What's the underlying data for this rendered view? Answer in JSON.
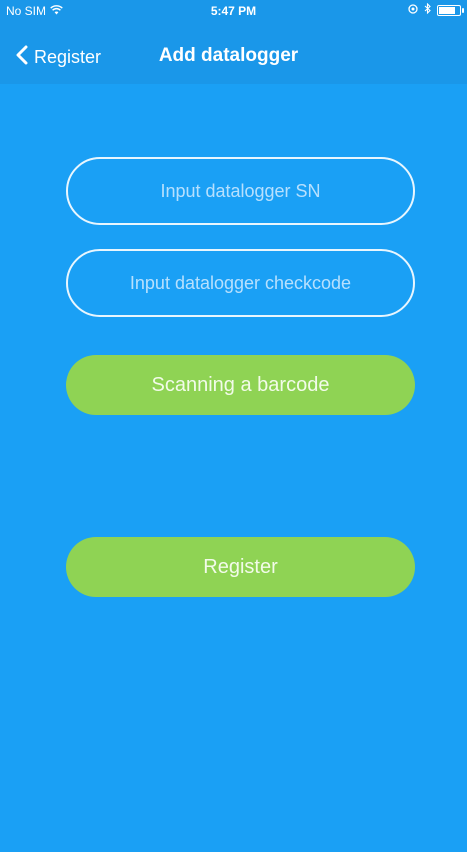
{
  "status_bar": {
    "carrier": "No SIM",
    "time": "5:47 PM"
  },
  "nav": {
    "back_label": "Register",
    "title": "Add datalogger"
  },
  "form": {
    "sn_placeholder": "Input datalogger SN",
    "sn_value": "",
    "checkcode_placeholder": "Input datalogger checkcode",
    "checkcode_value": "",
    "scan_label": "Scanning a barcode",
    "register_label": "Register"
  },
  "colors": {
    "background": "#1aa0f5",
    "button": "#8fd354"
  },
  "icons": {
    "wifi": "wifi-icon",
    "back": "chevron-left-icon",
    "location": "location-icon",
    "bluetooth": "bluetooth-icon",
    "battery": "battery-icon"
  }
}
